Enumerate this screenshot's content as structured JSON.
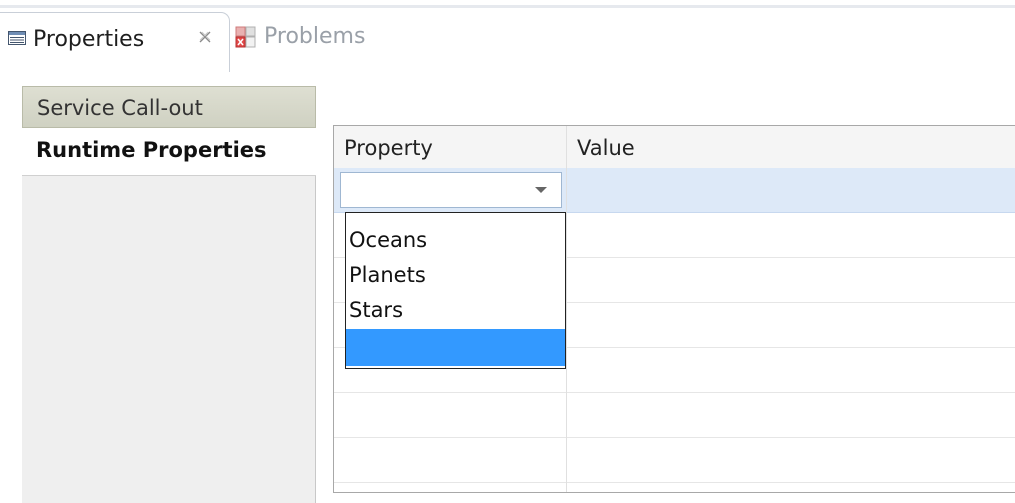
{
  "tabs": {
    "properties": {
      "label": "Properties",
      "close_glyph": "✗",
      "icon": "properties-icon"
    },
    "problems": {
      "label": "Problems",
      "icon": "problems-icon"
    }
  },
  "sections": [
    {
      "label": "Service Call-out",
      "selected": false
    },
    {
      "label": "Runtime Properties",
      "selected": true
    }
  ],
  "table": {
    "columns": [
      "Property",
      "Value"
    ],
    "rows": [
      {
        "property": "",
        "value": "",
        "editing": true
      },
      {
        "property": "",
        "value": ""
      },
      {
        "property": "",
        "value": ""
      },
      {
        "property": "",
        "value": ""
      },
      {
        "property": "",
        "value": ""
      },
      {
        "property": "",
        "value": ""
      },
      {
        "property": "",
        "value": ""
      }
    ]
  },
  "dropdown": {
    "options": [
      "Oceans",
      "Planets",
      "Stars",
      ""
    ],
    "highlighted_index": 3
  },
  "colors": {
    "selection_blue": "#3399ff",
    "row_selected": "#dde9f8"
  }
}
